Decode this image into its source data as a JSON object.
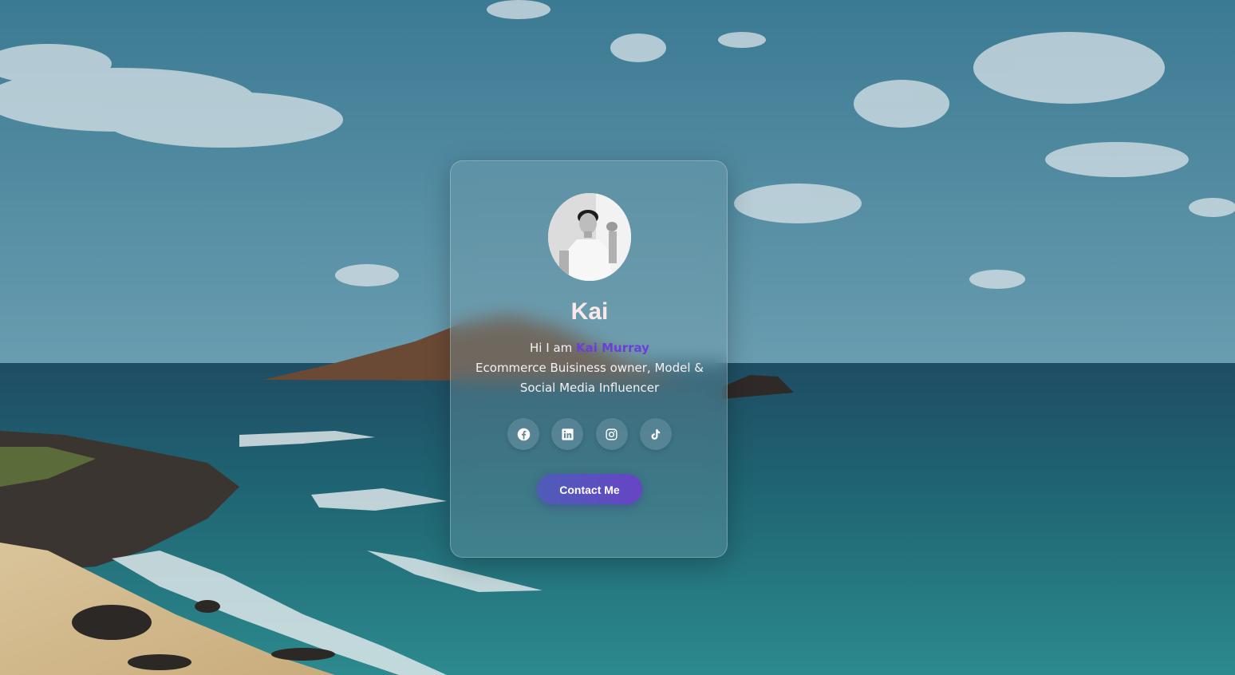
{
  "profile": {
    "name": "Kai",
    "greeting": "Hi I am ",
    "full_name": "Kai Murray",
    "bio": "Ecommerce Buisiness owner, Model & Social Media Influencer"
  },
  "socials": [
    {
      "icon": "facebook-icon"
    },
    {
      "icon": "linkedin-icon"
    },
    {
      "icon": "instagram-icon"
    },
    {
      "icon": "tiktok-icon"
    }
  ],
  "contact_button": {
    "label": "Contact Me"
  },
  "colors": {
    "accent": "#6a3fd8",
    "button_start": "#4e5db7",
    "button_end": "#6744c6",
    "name_text": "#fbe9ea"
  }
}
